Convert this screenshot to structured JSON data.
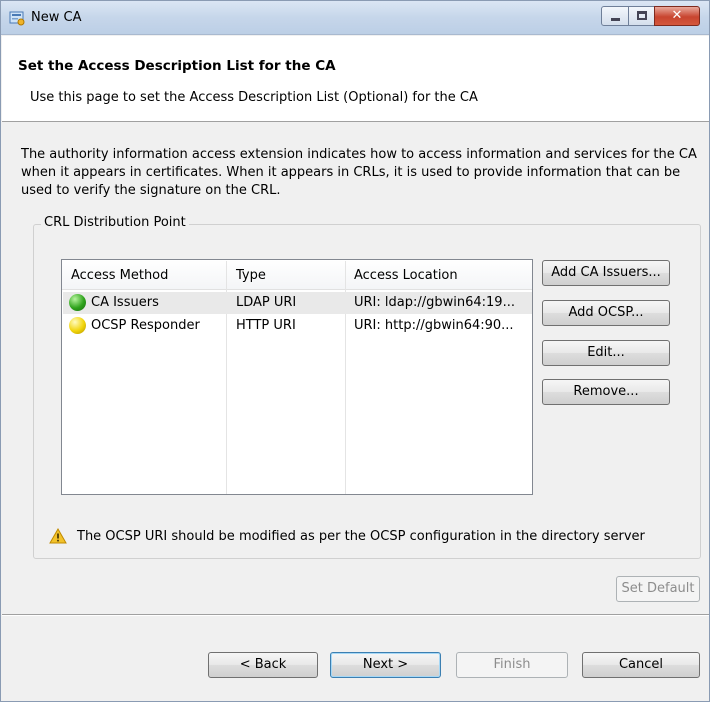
{
  "window": {
    "title": "New CA",
    "controls": {
      "minimize": "minimize",
      "maximize": "maximize",
      "close": "✕"
    }
  },
  "header": {
    "title": "Set the Access Description List for the CA",
    "subtitle": "Use this page to set the Access Description List (Optional) for the CA"
  },
  "description": "The authority information access extension indicates how to access information and services for the CA when it appears in certificates. When it appears in CRLs, it is used to provide information that can be used to verify the signature on the CRL.",
  "group": {
    "label": "CRL Distribution Point",
    "table": {
      "columns": [
        "Access Method",
        "Type",
        "Access Location"
      ],
      "rows": [
        {
          "method": "CA Issuers",
          "type": "LDAP URI",
          "location": "URI: ldap://gbwin64:19...",
          "status": "green",
          "selected": true
        },
        {
          "method": "OCSP Responder",
          "type": "HTTP URI",
          "location": "URI: http://gbwin64:90...",
          "status": "yellow",
          "selected": false
        }
      ]
    },
    "buttons": {
      "add_ca_issuers": "Add CA Issuers...",
      "add_ocsp": "Add OCSP...",
      "edit": "Edit...",
      "remove": "Remove..."
    },
    "warning": "The OCSP URI should be modified as per the OCSP configuration in the directory server"
  },
  "set_default": "Set Default",
  "footer": {
    "back": "< Back",
    "next": "Next >",
    "finish": "Finish",
    "cancel": "Cancel"
  },
  "colors": {
    "status_green": "#2fa31c",
    "status_yellow": "#f1d40a",
    "warning": "#f2c22a"
  }
}
